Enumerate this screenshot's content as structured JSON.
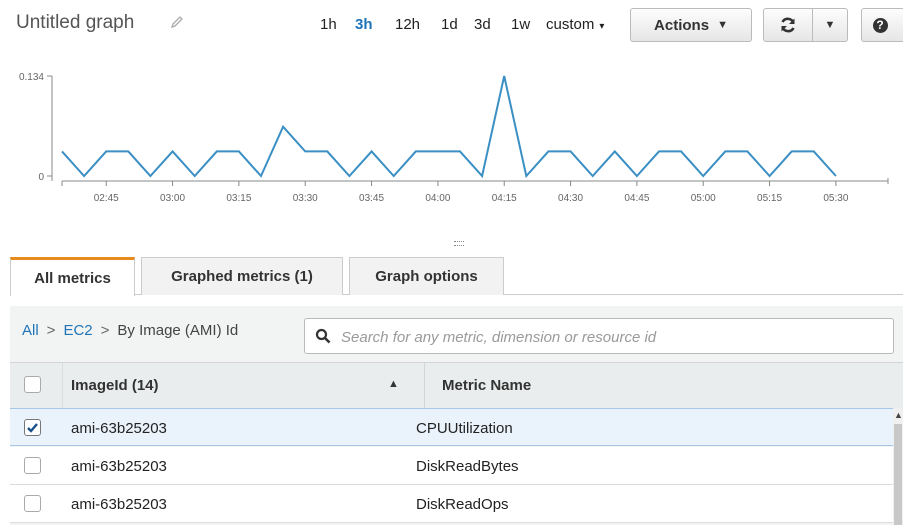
{
  "header": {
    "title": "Untitled graph",
    "ranges": [
      {
        "label": "1h",
        "active": false
      },
      {
        "label": "3h",
        "active": true
      },
      {
        "label": "12h",
        "active": false
      },
      {
        "label": "1d",
        "active": false
      },
      {
        "label": "3d",
        "active": false
      },
      {
        "label": "1w",
        "active": false
      },
      {
        "label": "custom",
        "active": false
      }
    ],
    "actions_label": "Actions"
  },
  "chart_data": {
    "type": "line",
    "x": [
      "02:35",
      "02:40",
      "02:45",
      "02:50",
      "02:55",
      "03:00",
      "03:05",
      "03:10",
      "03:15",
      "03:20",
      "03:25",
      "03:30",
      "03:35",
      "03:40",
      "03:45",
      "03:50",
      "03:55",
      "04:00",
      "04:05",
      "04:10",
      "04:15",
      "04:20",
      "04:25",
      "04:30",
      "04:35",
      "04:40",
      "04:45",
      "04:50",
      "04:55",
      "05:00",
      "05:05",
      "05:10",
      "05:15",
      "05:20",
      "05:25",
      "05:30",
      "05:35"
    ],
    "series": [
      {
        "values": [
          0.033,
          0,
          0.033,
          0.033,
          0,
          0.033,
          0,
          0.033,
          0.033,
          0,
          0.066,
          0.033,
          0.033,
          0,
          0.033,
          0,
          0.033,
          0.033,
          0.033,
          0,
          0.134,
          0,
          0.033,
          0.033,
          0,
          0.033,
          0,
          0.033,
          0.033,
          0,
          0.033,
          0.033,
          0,
          0.033,
          0.033,
          0
        ],
        "color": "#3a8fc4"
      }
    ],
    "xticks": [
      "02:45",
      "03:00",
      "03:15",
      "03:30",
      "03:45",
      "04:00",
      "04:15",
      "04:30",
      "04:45",
      "05:00",
      "05:15",
      "05:30"
    ],
    "yticks": [
      "0.134",
      "0"
    ],
    "ylim": [
      0,
      0.134
    ],
    "grid": false
  },
  "tabs": [
    {
      "label": "All metrics",
      "active": true
    },
    {
      "label": "Graphed metrics (1)",
      "active": false
    },
    {
      "label": "Graph options",
      "active": false
    }
  ],
  "breadcrumb": {
    "all": "All",
    "ec2": "EC2",
    "current": "By Image (AMI) Id",
    "sep": ">"
  },
  "search": {
    "placeholder": "Search for any metric, dimension or resource id"
  },
  "table": {
    "columns": [
      "ImageId (14)",
      "Metric Name"
    ],
    "rows": [
      {
        "image_id": "ami-63b25203",
        "metric": "CPUUtilization",
        "checked": true
      },
      {
        "image_id": "ami-63b25203",
        "metric": "DiskReadBytes",
        "checked": false
      },
      {
        "image_id": "ami-63b25203",
        "metric": "DiskReadOps",
        "checked": false
      }
    ]
  },
  "colors": {
    "accent": "#1f74b8",
    "tab_highlight": "#e88b1f",
    "line": "#3a8fc4"
  }
}
